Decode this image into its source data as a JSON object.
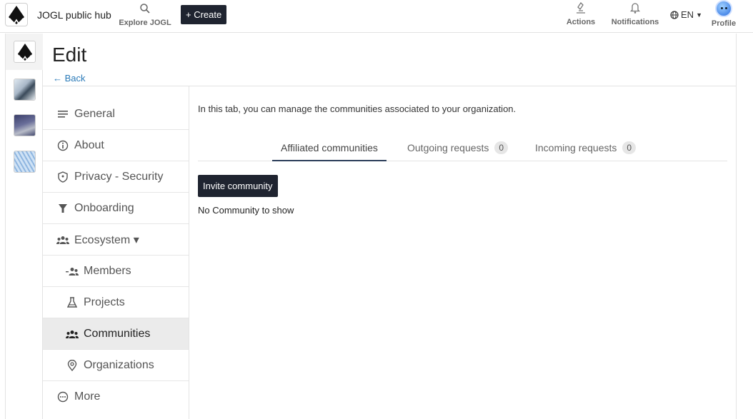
{
  "topbar": {
    "hub_name": "JOGL public hub",
    "explore_label": "Explore JOGL",
    "create_label": "+ Create",
    "actions_label": "Actions",
    "notifications_label": "Notifications",
    "language": "EN",
    "profile_label": "Profile"
  },
  "page": {
    "title": "Edit",
    "back_label": "← Back"
  },
  "sidebar": {
    "items": [
      {
        "label": "General",
        "icon": "lines-icon"
      },
      {
        "label": "About",
        "icon": "info-icon"
      },
      {
        "label": "Privacy - Security",
        "icon": "shield-icon"
      },
      {
        "label": "Onboarding",
        "icon": "filter-icon"
      },
      {
        "label": "Ecosystem ▾",
        "icon": "group-icon"
      },
      {
        "label": "Members",
        "icon": "group-icon"
      },
      {
        "label": "Projects",
        "icon": "flask-icon"
      },
      {
        "label": "Communities",
        "icon": "group-icon",
        "active": true
      },
      {
        "label": "Organizations",
        "icon": "location-icon"
      },
      {
        "label": "More",
        "icon": "more-icon"
      }
    ]
  },
  "content": {
    "intro": "In this tab, you can manage the communities associated to your organization.",
    "tabs": [
      {
        "label": "Affiliated communities"
      },
      {
        "label": "Outgoing requests",
        "count": "0"
      },
      {
        "label": "Incoming requests",
        "count": "0"
      }
    ],
    "invite_label": "Invite community",
    "empty_text": "No Community to show"
  },
  "colors": {
    "dark_button": "#1f2430",
    "link": "#2a7ab8",
    "active_item": "#ebebeb"
  }
}
